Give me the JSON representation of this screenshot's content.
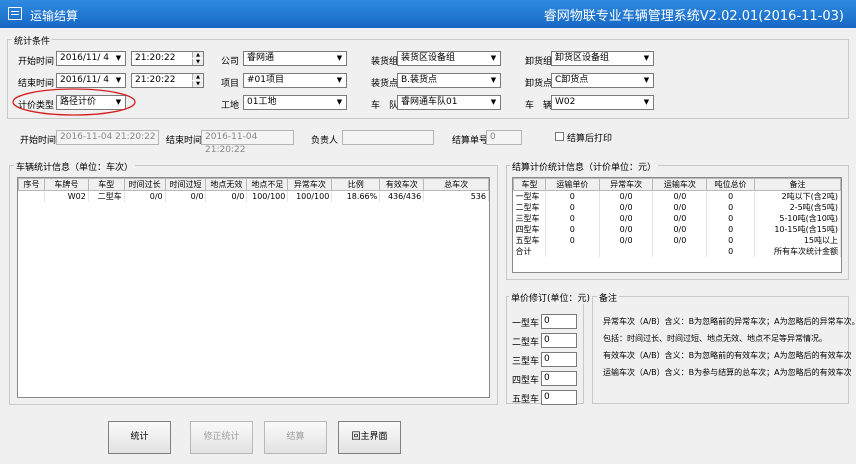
{
  "window": {
    "title": "运输结算",
    "app_title": "睿网物联专业车辆管理系统V2.02.01(2016-11-03)"
  },
  "conditions": {
    "group_label": "统计条件",
    "start_label": "开始时间",
    "start_date": "2016/11/  4",
    "start_time": "21:20:22",
    "end_label": "结束时间",
    "end_date": "2016/11/  4",
    "end_time": "21:20:22",
    "pricing_label": "计价类型",
    "pricing_value": "路径计价",
    "company_label": "公司",
    "company_value": "睿网通",
    "project_label": "项目",
    "project_value": "#01项目",
    "site_label": "工地",
    "site_value": "01工地",
    "load_group_label": "装货组",
    "load_group_value": "装货区设备组",
    "load_point_label": "装货点",
    "load_point_value": "B.装货点",
    "fleet_label": "车　队",
    "fleet_value": "睿网通车队01",
    "unload_group_label": "卸货组",
    "unload_group_value": "卸货区设备组",
    "unload_point_label": "卸货点",
    "unload_point_value": "C卸货点",
    "vehicle_label": "车　辆",
    "vehicle_value": "W02"
  },
  "info": {
    "start_label": "开始时间",
    "start_value": "2016-11-04 21:20:22",
    "end_label": "结束时间",
    "end_value": "2016-11-04 21:20:22",
    "owner_label": "负责人",
    "owner_value": "",
    "settle_no_label": "结算单号",
    "settle_no_value": "0",
    "print_label": "结算后打印"
  },
  "vehicle_stats": {
    "label": "车辆统计信息（单位：车次）",
    "headers": [
      "序号",
      "车牌号",
      "车型",
      "时间过长",
      "时间过短",
      "地点无效",
      "地点不足",
      "异常车次",
      "比例",
      "有效车次",
      "总车次"
    ],
    "rows": [
      [
        "",
        "W02",
        "二型车",
        "0/0",
        "0/0",
        "0/0",
        "100/100",
        "100/100",
        "18.66%",
        "436/436",
        "536"
      ]
    ]
  },
  "settle_stats": {
    "label": "结算计价统计信息（计价单位：元）",
    "headers": [
      "车型",
      "运输单价",
      "异常车次",
      "运输车次",
      "吨位总价",
      "备注"
    ],
    "rows": [
      [
        "一型车",
        "0",
        "0/0",
        "0/0",
        "0",
        "2吨以下(含2吨)"
      ],
      [
        "二型车",
        "0",
        "0/0",
        "0/0",
        "0",
        "2-5吨(含5吨)"
      ],
      [
        "三型车",
        "0",
        "0/0",
        "0/0",
        "0",
        "5-10吨(含10吨)"
      ],
      [
        "四型车",
        "0",
        "0/0",
        "0/0",
        "0",
        "10-15吨(含15吨)"
      ],
      [
        "五型车",
        "0",
        "0/0",
        "0/0",
        "0",
        "15吨以上"
      ],
      [
        "合计",
        "",
        "",
        "",
        "0",
        "所有车次统计金额"
      ]
    ]
  },
  "price_revise": {
    "label": "单价修订(单位：元)",
    "items": [
      {
        "label": "一型车",
        "value": "0"
      },
      {
        "label": "二型车",
        "value": "0"
      },
      {
        "label": "三型车",
        "value": "0"
      },
      {
        "label": "四型车",
        "value": "0"
      },
      {
        "label": "五型车",
        "value": "0"
      }
    ]
  },
  "remarks": {
    "label": "备注",
    "lines": [
      "异常车次（A/B）含义：B为忽略前的异常车次；A为忽略后的异常车次。",
      "包括：时间过长、时间过短、地点无效、地点不足等异常情况。",
      "有效车次（A/B）含义：B为忽略前的有效车次；A为忽略后的有效车次",
      "运输车次（A/B）含义：B为参与结算的总车次；A为忽略后的有效车次"
    ]
  },
  "buttons": {
    "stat": "统计",
    "revise": "修正统计",
    "settle": "结算",
    "back": "回主界面"
  },
  "colors": {
    "titlebar": "#1c74d1",
    "highlight_ellipse": "#d42020"
  }
}
